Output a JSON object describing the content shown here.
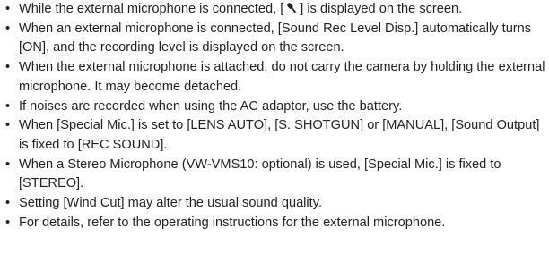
{
  "notes": [
    {
      "bullet": "•",
      "before_icon": "While the external microphone is connected, [",
      "icon": "external-microphone-icon",
      "after_icon": "] is displayed on the screen."
    },
    {
      "bullet": "•",
      "text": "When an external microphone is connected, [Sound Rec Level Disp.] automatically turns [ON], and the recording level is displayed on the screen."
    },
    {
      "bullet": "•",
      "text": "When the external microphone is attached, do not carry the camera by holding the external microphone. It may become detached."
    },
    {
      "bullet": "•",
      "text": "If noises are recorded when using the AC adaptor, use the battery."
    },
    {
      "bullet": "•",
      "text": "When [Special Mic.] is set to [LENS AUTO], [S. SHOTGUN] or [MANUAL], [Sound Output] is fixed to [REC SOUND]."
    },
    {
      "bullet": "•",
      "text": "When a Stereo Microphone (VW-VMS10: optional) is used, [Special Mic.] is fixed to [STEREO]."
    },
    {
      "bullet": "•",
      "text": "Setting [Wind Cut] may alter the usual sound quality."
    },
    {
      "bullet": "•",
      "text": "For details, refer to the operating instructions for the external microphone."
    }
  ]
}
